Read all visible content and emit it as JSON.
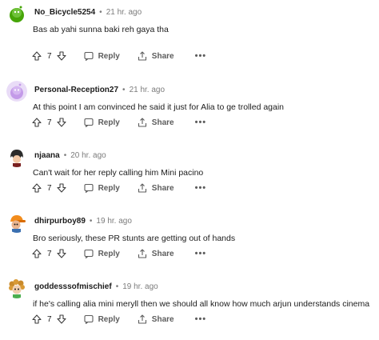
{
  "comments": [
    {
      "username": "No_Bicycle5254",
      "time": "21 hr. ago",
      "body": "Bas ab yahi sunna baki reh gaya tha",
      "votes": "7",
      "reply_label": "Reply",
      "share_label": "Share",
      "more_label": "•••",
      "avatar": "green-snoo-avatar"
    },
    {
      "username": "Personal-Reception27",
      "time": "21 hr. ago",
      "body": "At this point I am convinced he said it just for Alia to ge trolled again",
      "votes": "7",
      "reply_label": "Reply",
      "share_label": "Share",
      "more_label": "•••",
      "avatar": "purple-snoo-avatar"
    },
    {
      "username": "njaana",
      "time": "20 hr. ago",
      "body": "Can't wait for her reply calling him Mini pacino",
      "votes": "7",
      "reply_label": "Reply",
      "share_label": "Share",
      "more_label": "•••",
      "avatar": "dark-hair-avatar"
    },
    {
      "username": "dhirpurboy89",
      "time": "19 hr. ago",
      "body": "Bro seriously, these PR stunts are getting out of hands",
      "votes": "7",
      "reply_label": "Reply",
      "share_label": "Share",
      "more_label": "•••",
      "avatar": "orange-cap-avatar"
    },
    {
      "username": "goddesssofmischief",
      "time": "19 hr. ago",
      "body": "if he's calling alia mini meryll then we should all know how much arjun understands cinema",
      "votes": "7",
      "reply_label": "Reply",
      "share_label": "Share",
      "more_label": "•••",
      "avatar": "curly-hair-avatar"
    }
  ],
  "colors": {
    "text": "#1c1c1c",
    "meta": "#7c7c7c",
    "action": "#5c5c5c"
  }
}
